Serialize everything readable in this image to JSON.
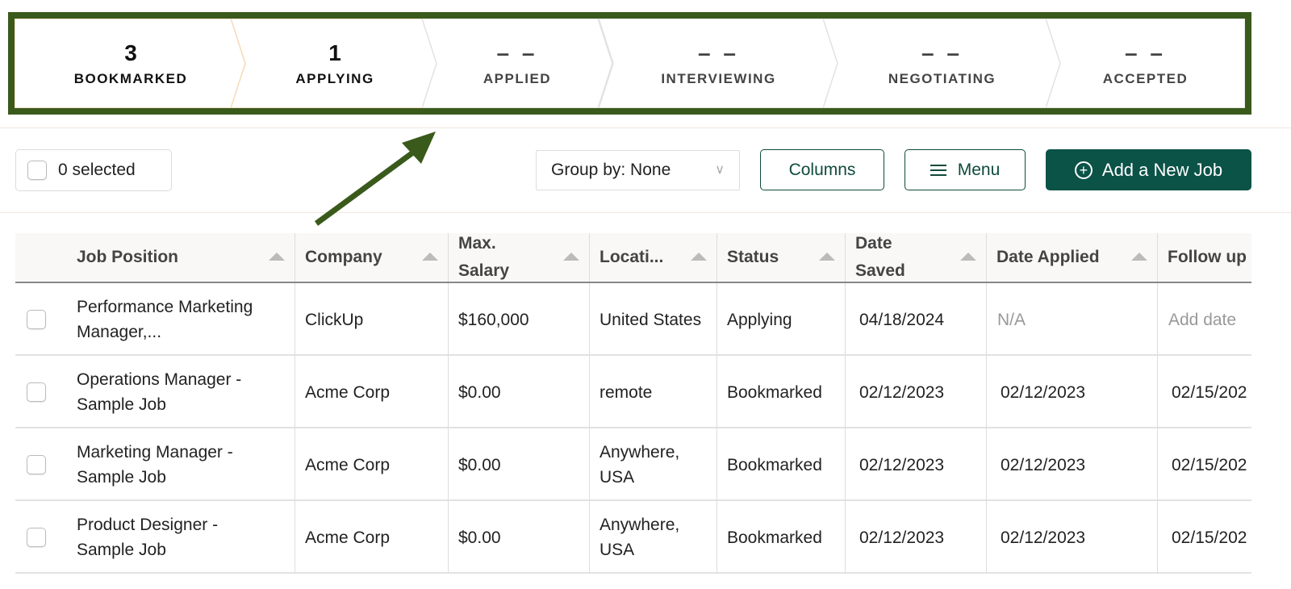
{
  "pipeline": {
    "stages": [
      {
        "count": "3",
        "label": "BOOKMARKED",
        "active": true
      },
      {
        "count": "1",
        "label": "APPLYING",
        "active": true
      },
      {
        "count": "– –",
        "label": "APPLIED",
        "active": false
      },
      {
        "count": "– –",
        "label": "INTERVIEWING",
        "active": false
      },
      {
        "count": "– –",
        "label": "NEGOTIATING",
        "active": false
      },
      {
        "count": "– –",
        "label": "ACCEPTED",
        "active": false
      }
    ],
    "highlight_color": "#3a5a1c",
    "active_border_color": "#f7d9b8",
    "inactive_border_color": "#e2e2e2"
  },
  "toolbar": {
    "selected_label": "0 selected",
    "group_by_label": "Group by: None",
    "group_by_chevron": "∨",
    "columns_label": "Columns",
    "menu_label": "Menu",
    "add_job_label": "Add a New Job",
    "add_job_icon": "+",
    "brand_color": "#0b5247"
  },
  "table": {
    "columns": [
      {
        "label": "Job Position"
      },
      {
        "label": "Company"
      },
      {
        "label": "Max. Salary"
      },
      {
        "label": "Locati..."
      },
      {
        "label": "Status"
      },
      {
        "label": "Date Saved"
      },
      {
        "label": "Date Applied"
      },
      {
        "label": "Follow up"
      }
    ],
    "rows": [
      {
        "position": "Performance Marketing Manager,...",
        "company": "ClickUp",
        "salary": "$160,000",
        "location": "United States",
        "status": "Applying",
        "date_saved": "04/18/2024",
        "date_applied": "N/A",
        "follow_up": "Add date"
      },
      {
        "position": "Operations Manager - Sample Job",
        "company": "Acme Corp",
        "salary": "$0.00",
        "location": "remote",
        "status": "Bookmarked",
        "date_saved": "02/12/2023",
        "date_applied": "02/12/2023",
        "follow_up": "02/15/202"
      },
      {
        "position": "Marketing Manager - Sample Job",
        "company": "Acme Corp",
        "salary": "$0.00",
        "location": "Anywhere, USA",
        "status": "Bookmarked",
        "date_saved": "02/12/2023",
        "date_applied": "02/12/2023",
        "follow_up": "02/15/202"
      },
      {
        "position": "Product Designer - Sample Job",
        "company": "Acme Corp",
        "salary": "$0.00",
        "location": "Anywhere, USA",
        "status": "Bookmarked",
        "date_saved": "02/12/2023",
        "date_applied": "02/12/2023",
        "follow_up": "02/15/202"
      }
    ]
  },
  "annotation": {
    "arrow_color": "#3a5a1c"
  }
}
